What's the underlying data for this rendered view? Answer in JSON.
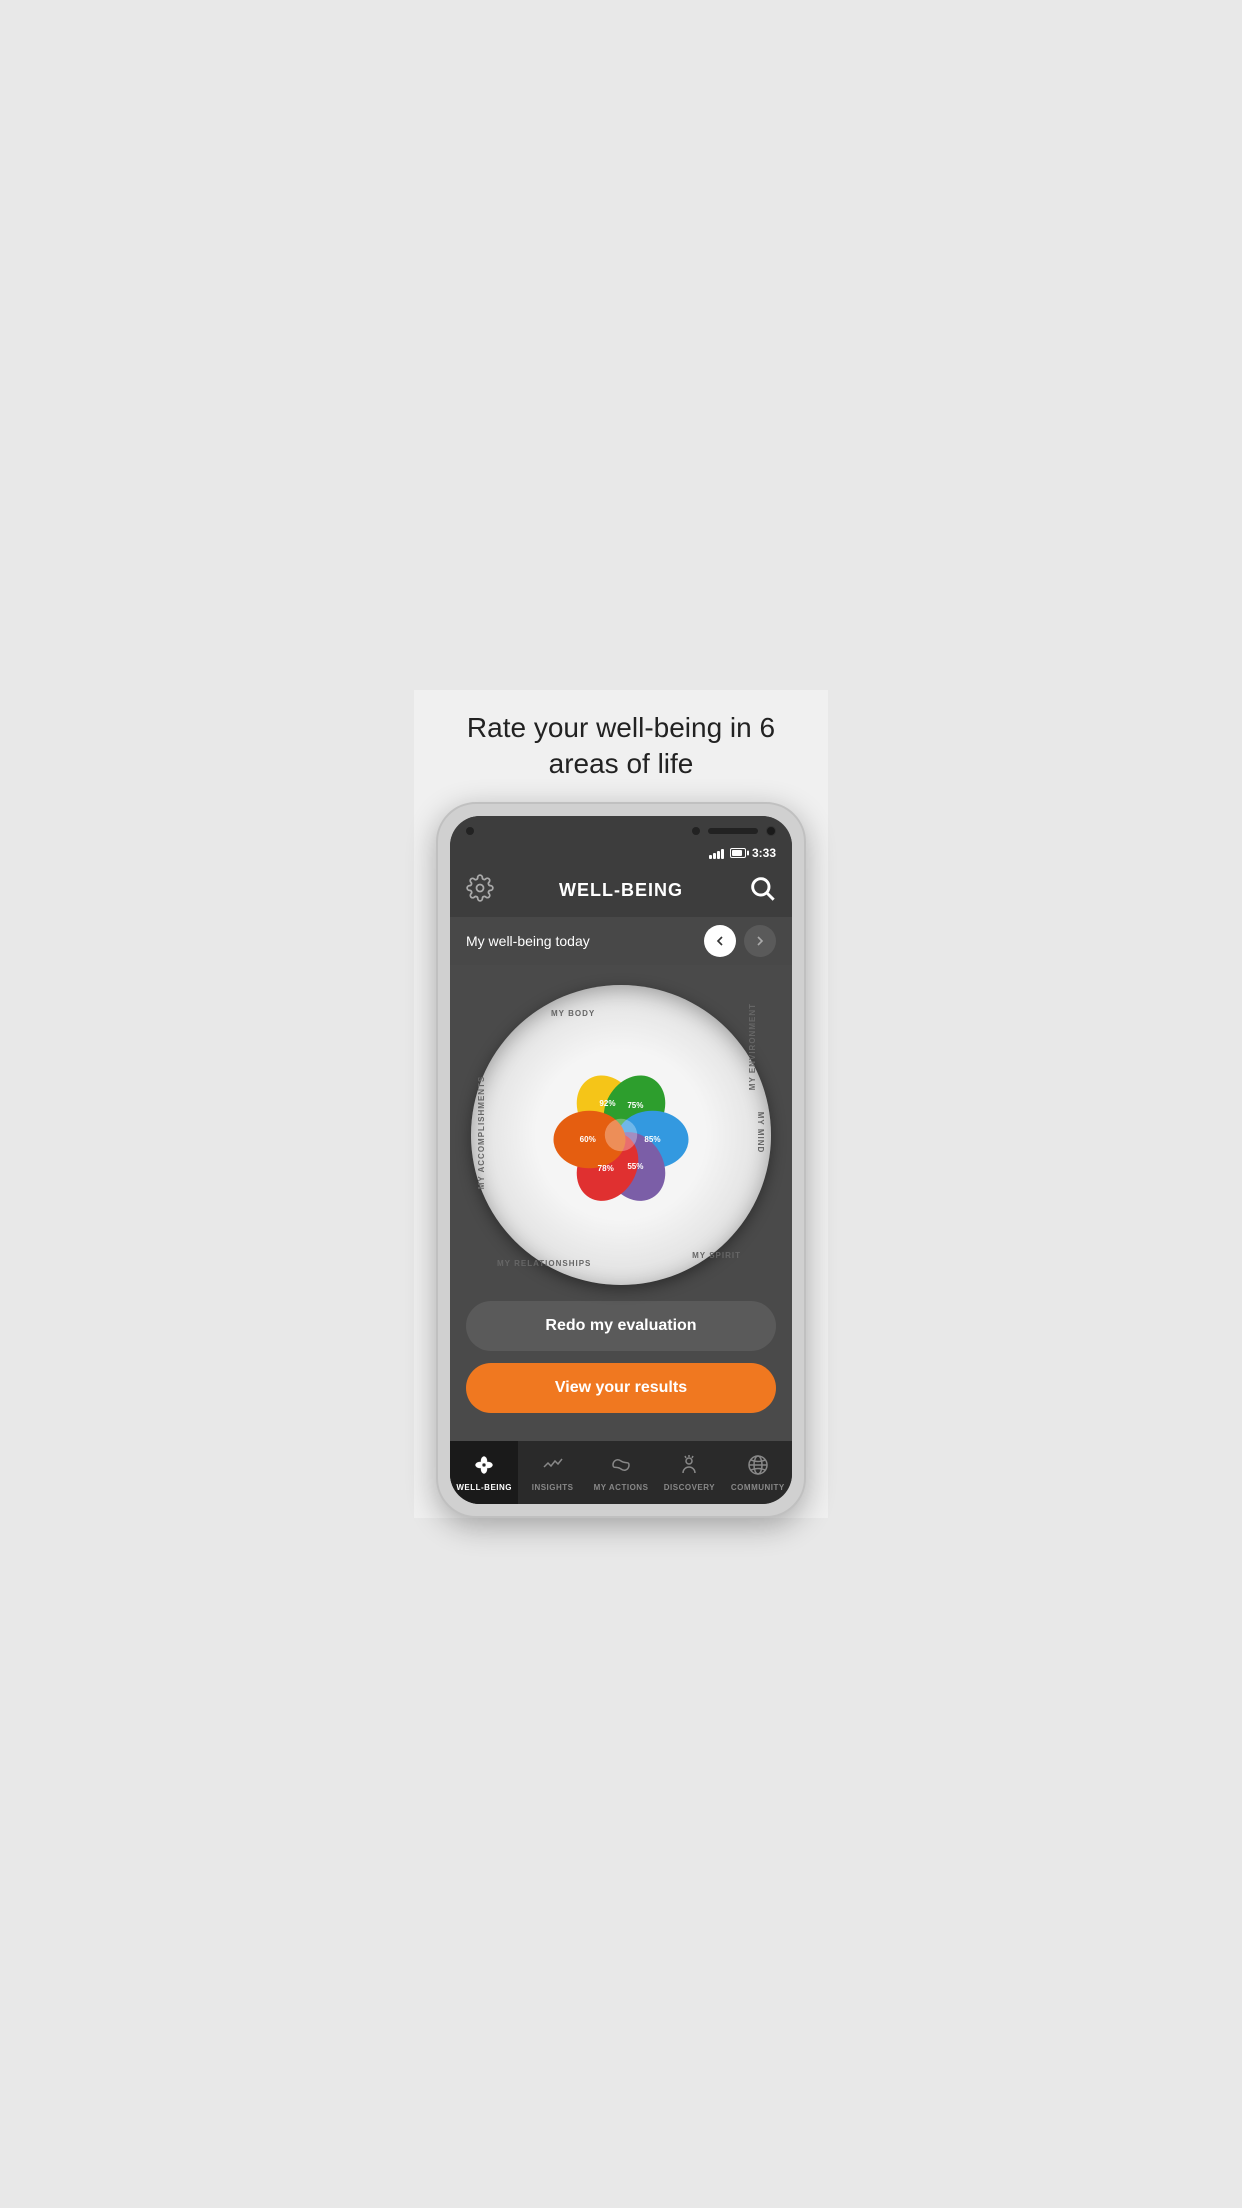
{
  "header": {
    "title": "Rate your well-being\nin 6 areas of life"
  },
  "app": {
    "title": "WELL-BEING",
    "statusBar": {
      "time": "3:33"
    },
    "navBar": {
      "label": "My well-being today"
    },
    "flower": {
      "areas": [
        {
          "name": "MY BODY",
          "value": "92%",
          "color": "#f5c518"
        },
        {
          "name": "MY ENVIRONMENT",
          "value": "75%",
          "color": "#2d9e2d"
        },
        {
          "name": "MY MIND",
          "value": "85%",
          "color": "#3399e0"
        },
        {
          "name": "MY SPIRIT",
          "value": "55%",
          "color": "#7b5ea7"
        },
        {
          "name": "MY RELATIONSHIPS",
          "value": "78%",
          "color": "#e03030"
        },
        {
          "name": "MY ACCOMPLISHMENTS",
          "value": "60%",
          "color": "#e55e10"
        }
      ]
    },
    "buttons": {
      "redo": "Redo my evaluation",
      "view": "View your results"
    },
    "bottomNav": [
      {
        "id": "wellbeing",
        "label": "WELL-BEING",
        "active": true
      },
      {
        "id": "insights",
        "label": "INSIGHTS",
        "active": false
      },
      {
        "id": "myactions",
        "label": "MY ACTIONS",
        "active": false
      },
      {
        "id": "discovery",
        "label": "DISCOVERY",
        "active": false
      },
      {
        "id": "community",
        "label": "COMMUNITY",
        "active": false
      }
    ]
  }
}
